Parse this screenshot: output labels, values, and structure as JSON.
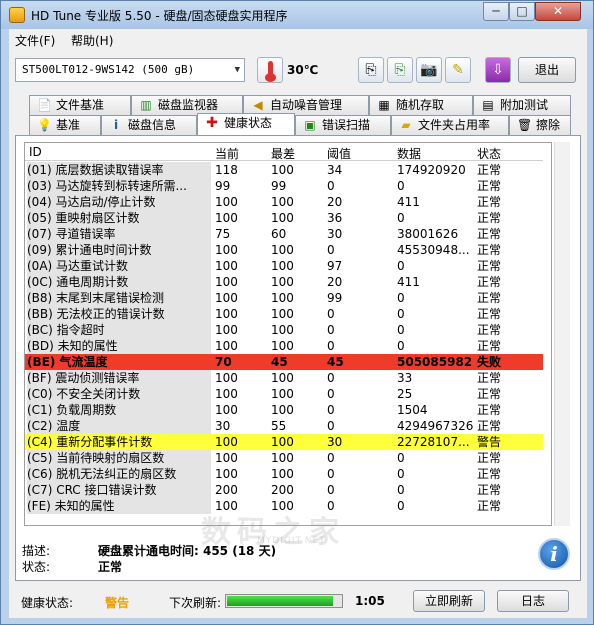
{
  "app": {
    "title": "HD Tune 专业版 5.50 - 硬盘/固态硬盘实用程序",
    "window_buttons": {
      "minimize": "─",
      "maximize": "□",
      "close": "✕"
    }
  },
  "menu": {
    "file": "文件(F)",
    "help": "帮助(H)"
  },
  "toolbar": {
    "drive": "ST500LT012-9WS142 (500 gB)",
    "temperature": "30℃",
    "exit_label": "退出"
  },
  "tabs_row1": [
    {
      "label": "文件基准",
      "icon": "file-benchmark-icon"
    },
    {
      "label": "磁盘监视器",
      "icon": "disk-monitor-icon"
    },
    {
      "label": "自动噪音管理",
      "icon": "speaker-icon"
    },
    {
      "label": "随机存取",
      "icon": "random-access-icon"
    },
    {
      "label": "附加测试",
      "icon": "extra-tests-icon"
    }
  ],
  "tabs_row2": [
    {
      "label": "基准",
      "icon": "lightbulb-icon"
    },
    {
      "label": "磁盘信息",
      "icon": "info-icon"
    },
    {
      "label": "健康状态",
      "icon": "health-cross-icon",
      "active": true
    },
    {
      "label": "错误扫描",
      "icon": "error-scan-icon"
    },
    {
      "label": "文件夹占用率",
      "icon": "folder-icon"
    },
    {
      "label": "擦除",
      "icon": "trash-icon"
    }
  ],
  "table": {
    "headers": [
      "ID",
      "当前",
      "最差",
      "阈值",
      "数据",
      "状态"
    ],
    "rows": [
      {
        "id": "(01) 底层数据读取错误率",
        "cur": "118",
        "worst": "100",
        "thr": "34",
        "data": "174920920",
        "status": "正常"
      },
      {
        "id": "(03) 马达旋转到标转速所需...",
        "cur": "99",
        "worst": "99",
        "thr": "0",
        "data": "0",
        "status": "正常"
      },
      {
        "id": "(04) 马达启动/停止计数",
        "cur": "100",
        "worst": "100",
        "thr": "20",
        "data": "411",
        "status": "正常"
      },
      {
        "id": "(05) 重映射扇区计数",
        "cur": "100",
        "worst": "100",
        "thr": "36",
        "data": "0",
        "status": "正常"
      },
      {
        "id": "(07) 寻道错误率",
        "cur": "75",
        "worst": "60",
        "thr": "30",
        "data": "38001626",
        "status": "正常"
      },
      {
        "id": "(09) 累计通电时间计数",
        "cur": "100",
        "worst": "100",
        "thr": "0",
        "data": "45530948...",
        "status": "正常"
      },
      {
        "id": "(0A) 马达重试计数",
        "cur": "100",
        "worst": "100",
        "thr": "97",
        "data": "0",
        "status": "正常"
      },
      {
        "id": "(0C) 通电周期计数",
        "cur": "100",
        "worst": "100",
        "thr": "20",
        "data": "411",
        "status": "正常"
      },
      {
        "id": "(B8) 末尾到末尾错误检测",
        "cur": "100",
        "worst": "100",
        "thr": "99",
        "data": "0",
        "status": "正常"
      },
      {
        "id": "(BB) 无法校正的错误计数",
        "cur": "100",
        "worst": "100",
        "thr": "0",
        "data": "0",
        "status": "正常"
      },
      {
        "id": "(BC) 指令超时",
        "cur": "100",
        "worst": "100",
        "thr": "0",
        "data": "0",
        "status": "正常"
      },
      {
        "id": "(BD) 未知的属性",
        "cur": "100",
        "worst": "100",
        "thr": "0",
        "data": "0",
        "status": "正常"
      },
      {
        "id": "(BE) 气流温度",
        "cur": "70",
        "worst": "45",
        "thr": "45",
        "data": "505085982",
        "status": "失败",
        "highlight": "red"
      },
      {
        "id": "(BF) 震动侦测错误率",
        "cur": "100",
        "worst": "100",
        "thr": "0",
        "data": "33",
        "status": "正常"
      },
      {
        "id": "(C0) 不安全关闭计数",
        "cur": "100",
        "worst": "100",
        "thr": "0",
        "data": "25",
        "status": "正常"
      },
      {
        "id": "(C1) 负载周期数",
        "cur": "100",
        "worst": "100",
        "thr": "0",
        "data": "1504",
        "status": "正常"
      },
      {
        "id": "(C2) 温度",
        "cur": "30",
        "worst": "55",
        "thr": "0",
        "data": "4294967326",
        "status": "正常"
      },
      {
        "id": "(C4) 重新分配事件计数",
        "cur": "100",
        "worst": "100",
        "thr": "30",
        "data": "22728107...",
        "status": "警告",
        "highlight": "yellow"
      },
      {
        "id": "(C5) 当前待映射的扇区数",
        "cur": "100",
        "worst": "100",
        "thr": "0",
        "data": "0",
        "status": "正常"
      },
      {
        "id": "(C6) 脱机无法纠正的扇区数",
        "cur": "100",
        "worst": "100",
        "thr": "0",
        "data": "0",
        "status": "正常"
      },
      {
        "id": "(C7) CRC 接口错误计数",
        "cur": "200",
        "worst": "200",
        "thr": "0",
        "data": "0",
        "status": "正常"
      },
      {
        "id": "(FE) 未知的属性",
        "cur": "100",
        "worst": "100",
        "thr": "0",
        "data": "0",
        "status": "正常"
      }
    ]
  },
  "details": {
    "desc_label": "描述:",
    "desc_value": "硬盘累计通电时间: 455 (18 天)",
    "state_label": "状态:",
    "state_value": "正常"
  },
  "status_bar": {
    "health_label": "健康状态:",
    "health_value": "警告",
    "health_color": "#f0a000",
    "next_refresh_label": "下次刷新:",
    "progress_fraction": 0.93,
    "countdown": "1:05",
    "refresh_button": "立即刷新",
    "log_button": "日志"
  },
  "watermark": {
    "text": "数码之家",
    "sub": "MYDIGIT.NET"
  }
}
